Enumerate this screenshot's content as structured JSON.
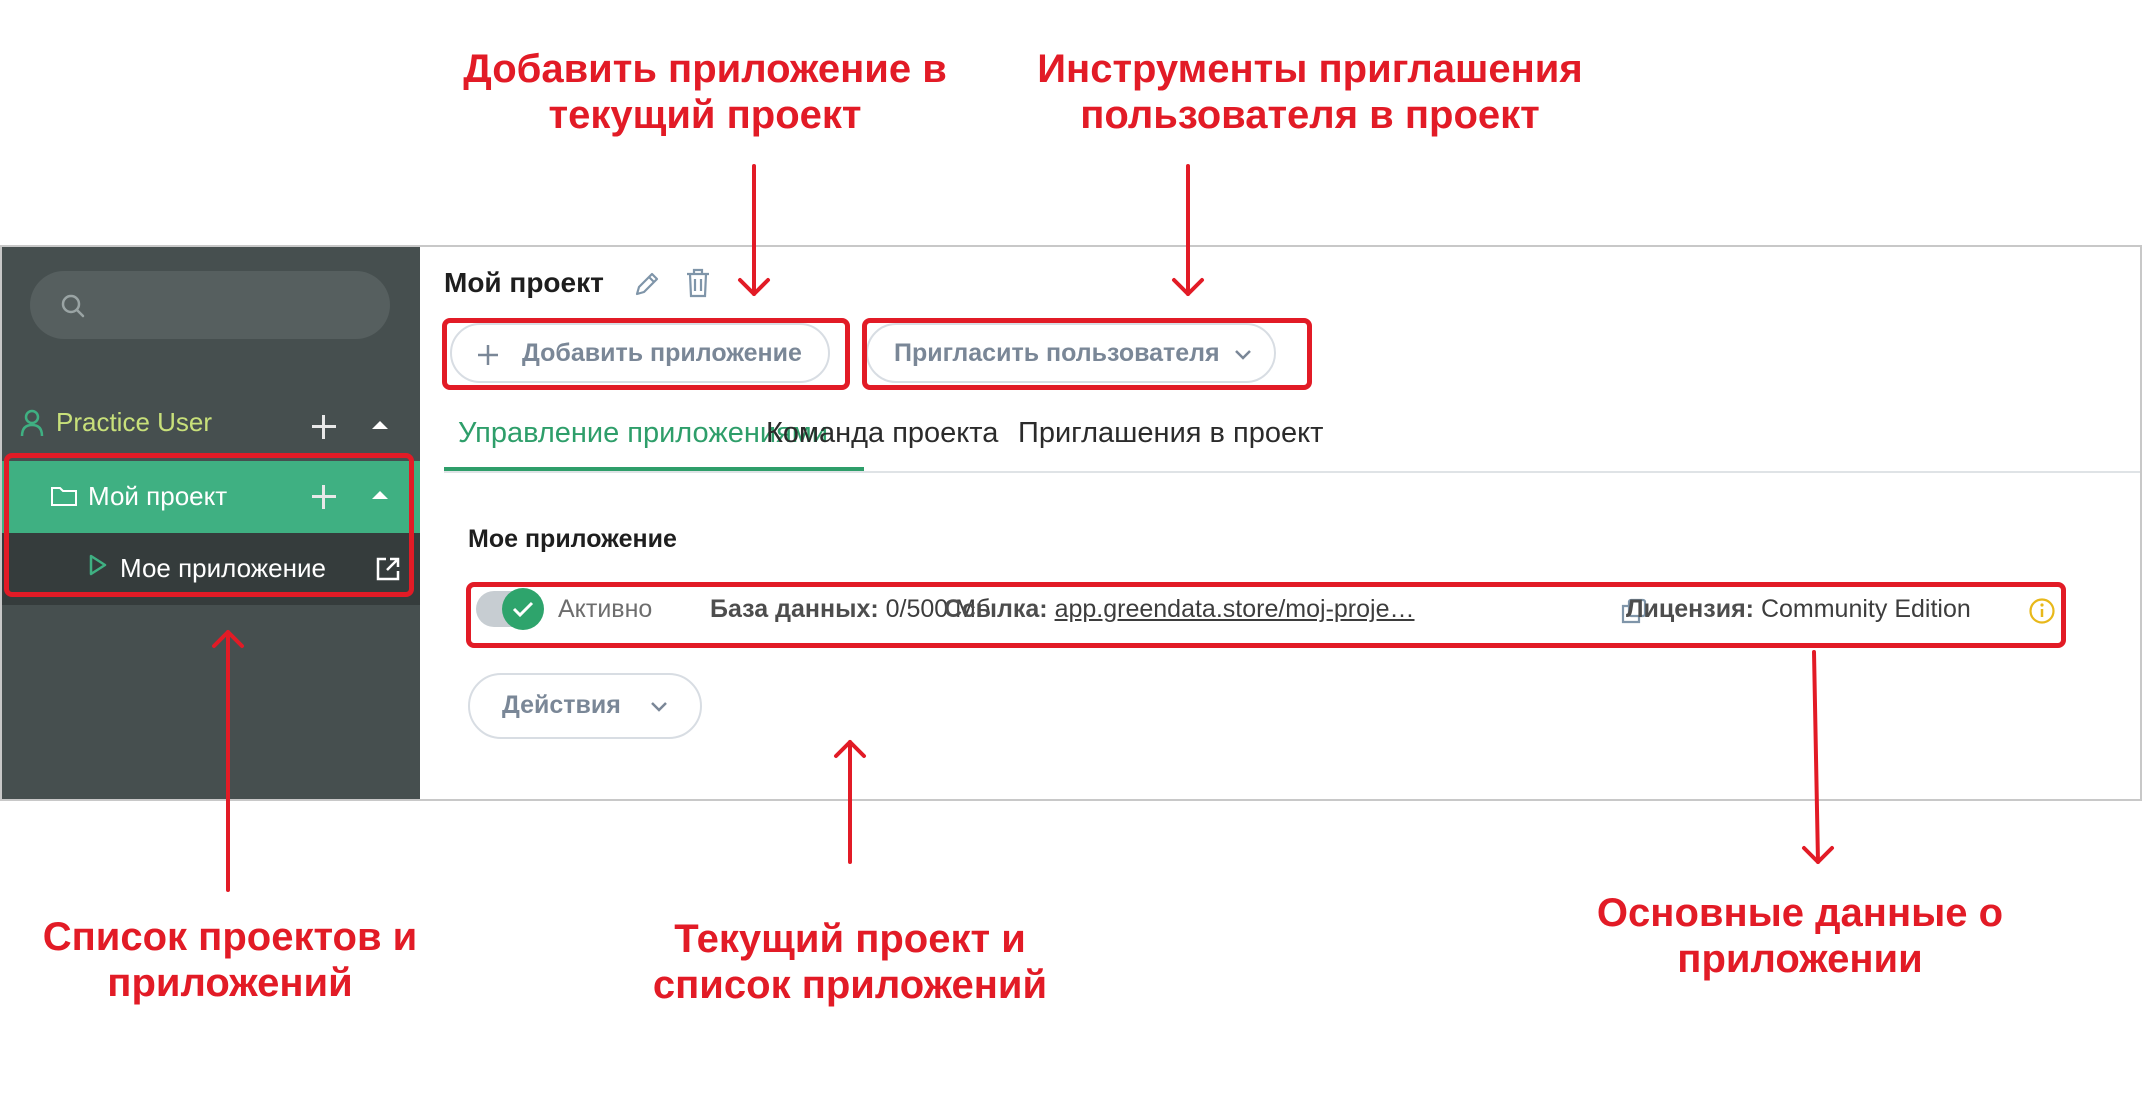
{
  "annotations": {
    "add_app": "Добавить приложение в текущий проект",
    "invite_tools": "Инструменты приглашения пользователя в проект",
    "projects_list": "Список проектов и приложений",
    "current_project": "Текущий проект и список приложений",
    "app_info": "Основные данные о приложении"
  },
  "sidebar": {
    "search_placeholder": "",
    "user": {
      "label": "Practice User"
    },
    "project": {
      "label": "Мой проект"
    },
    "app": {
      "label": "Мое приложение"
    }
  },
  "header": {
    "title": "Мой проект",
    "add_app_label": "Добавить приложение",
    "invite_label": "Пригласить пользователя"
  },
  "tabs": [
    {
      "label": "Управление приложениями",
      "active": true
    },
    {
      "label": "Команда проекта",
      "active": false
    },
    {
      "label": "Приглашения в проект",
      "active": false
    }
  ],
  "app_card": {
    "title": "Мое приложение",
    "status": "Активно",
    "db_label": "База данных:",
    "db_value": "0/500 Мб",
    "link_label": "Ссылка:",
    "link_value": "app.greendata.store/moj-proje…",
    "license_label": "Лицензия:",
    "license_value": "Community Edition"
  },
  "actions_label": "Действия",
  "colors": {
    "accent_green": "#3fb082",
    "annotation_red": "#e21b26",
    "sidebar_bg": "#464f4f"
  }
}
